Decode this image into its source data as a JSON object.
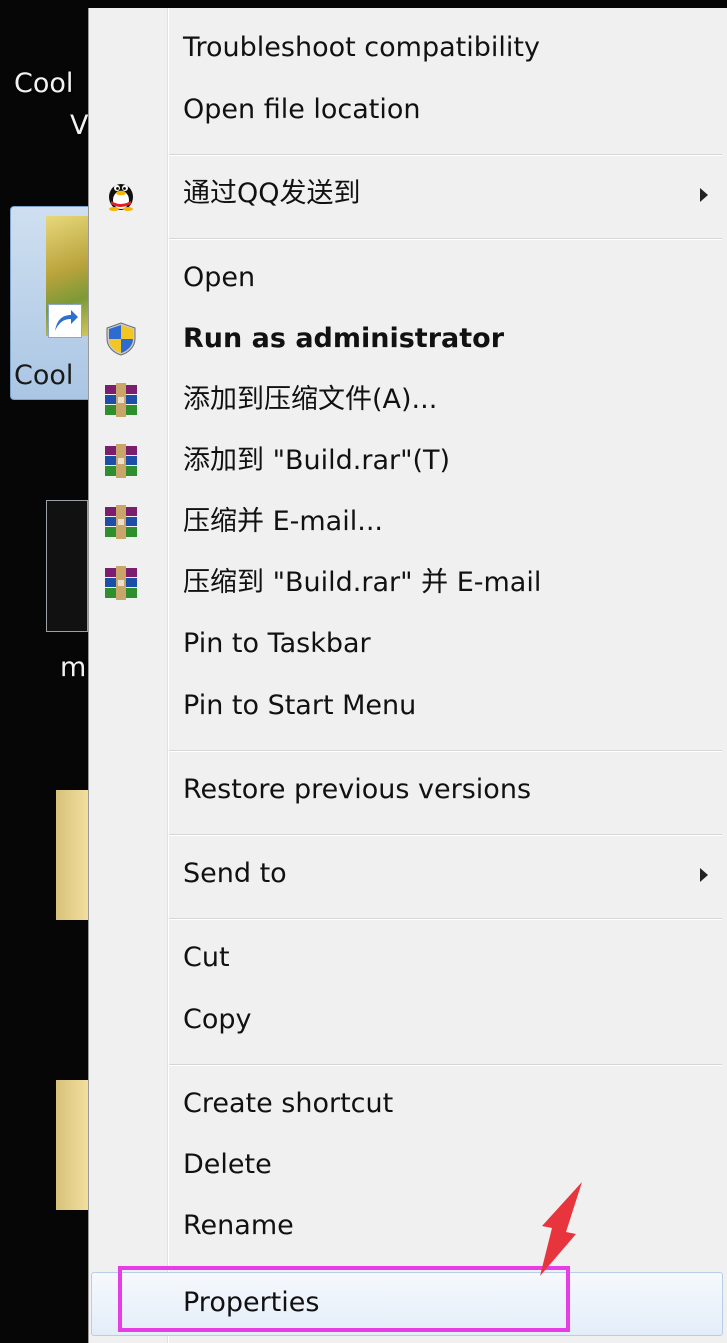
{
  "desktop": {
    "labels": [
      "Cool",
      "V",
      "Cool",
      "m"
    ]
  },
  "menu": {
    "items": [
      {
        "label": "Troubleshoot compatibility",
        "icon": null
      },
      {
        "label": "Open file location",
        "icon": null
      },
      {
        "label": "通过QQ发送到",
        "icon": "qq-penguin-icon",
        "submenu": true
      },
      {
        "label": "Open",
        "icon": null
      },
      {
        "label": "Run as administrator",
        "icon": "uac-shield-icon",
        "bold": true
      },
      {
        "label": "添加到压缩文件(A)...",
        "icon": "winrar-icon"
      },
      {
        "label": "添加到 \"Build.rar\"(T)",
        "icon": "winrar-icon"
      },
      {
        "label": "压缩并 E-mail...",
        "icon": "winrar-icon"
      },
      {
        "label": "压缩到 \"Build.rar\" 并 E-mail",
        "icon": "winrar-icon"
      },
      {
        "label": "Pin to Taskbar",
        "icon": null
      },
      {
        "label": "Pin to Start Menu",
        "icon": null
      },
      {
        "label": "Restore previous versions",
        "icon": null
      },
      {
        "label": "Send to",
        "icon": null,
        "submenu": true
      },
      {
        "label": "Cut",
        "icon": null
      },
      {
        "label": "Copy",
        "icon": null
      },
      {
        "label": "Create shortcut",
        "icon": null
      },
      {
        "label": "Delete",
        "icon": null
      },
      {
        "label": "Rename",
        "icon": null
      },
      {
        "label": "Properties",
        "icon": null,
        "highlighted": true
      }
    ]
  },
  "colors": {
    "annotation": "#e63de7",
    "annotation_arrow": "#e8343c",
    "menu_bg": "#f0f0f0"
  }
}
